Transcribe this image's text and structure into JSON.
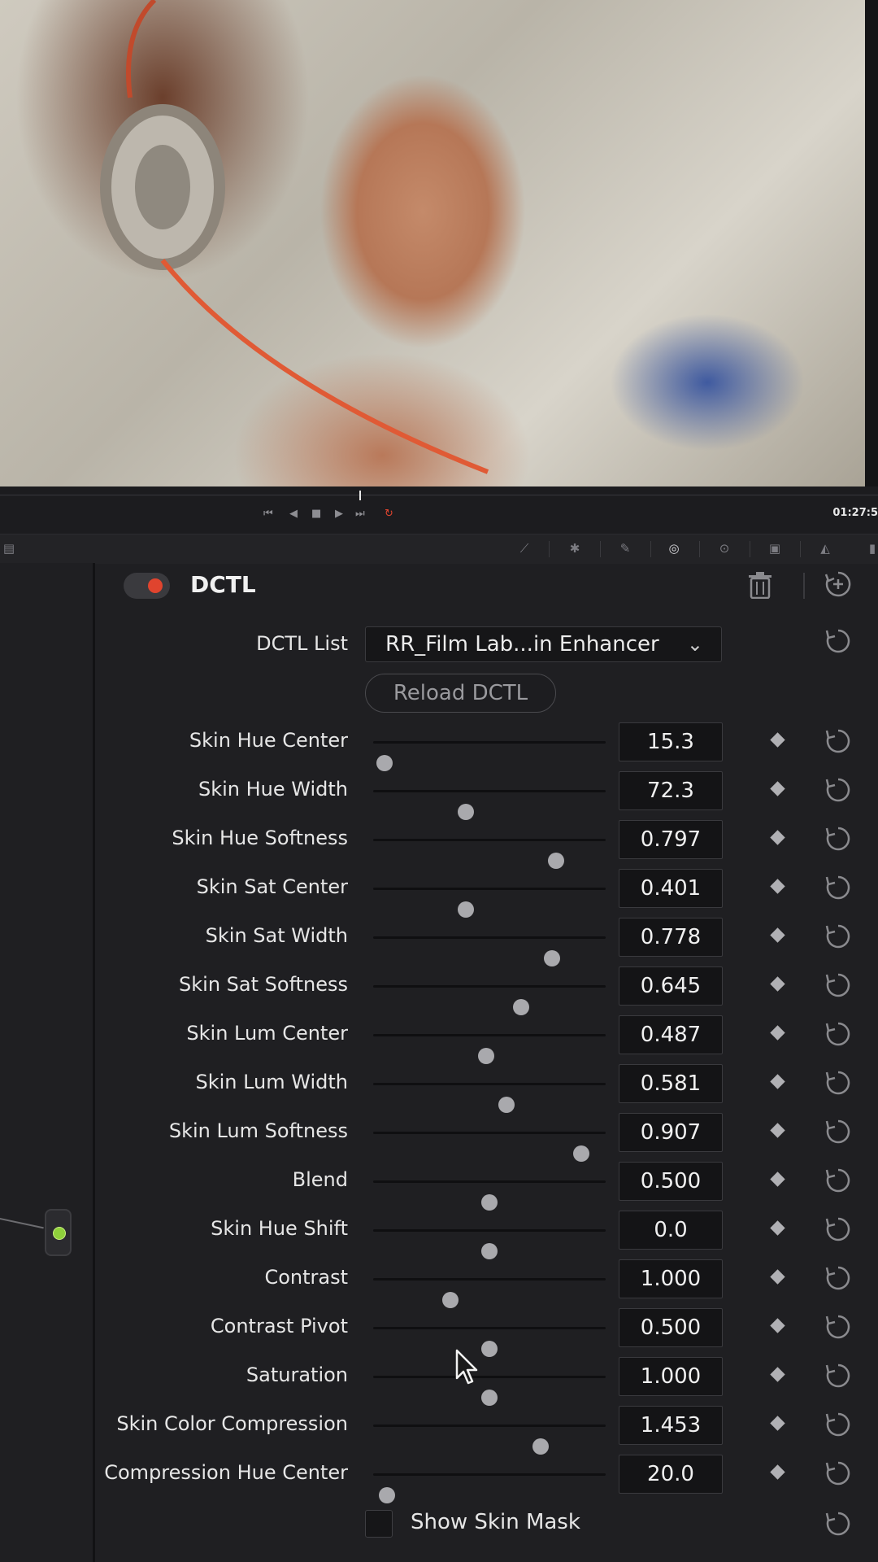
{
  "transport": {
    "timecode": "01:27:5",
    "buttons": [
      "skip-to-start-icon",
      "step-back-icon",
      "stop-icon",
      "play-icon",
      "skip-to-end-icon",
      "loop-icon"
    ]
  },
  "toolstrip": {
    "tools": [
      "curves-icon",
      "color-warper-icon",
      "qualifier-icon",
      "window-icon",
      "tracker-icon",
      "magic-mask-icon",
      "blur-icon",
      "key-icon"
    ]
  },
  "panel": {
    "title": "DCTL",
    "enabled": true
  },
  "dctl_list": {
    "label": "DCTL List",
    "selected": "RR_Film Lab...in Enhancer"
  },
  "reload_label": "Reload DCTL",
  "params": [
    {
      "label": "Skin Hue Center",
      "value": "15.3",
      "slider": 0.05
    },
    {
      "label": "Skin Hue Width",
      "value": "72.3",
      "slider": 0.4
    },
    {
      "label": "Skin Hue Softness",
      "value": "0.797",
      "slider": 0.786
    },
    {
      "label": "Skin Sat Center",
      "value": "0.401",
      "slider": 0.4
    },
    {
      "label": "Skin Sat Width",
      "value": "0.778",
      "slider": 0.768
    },
    {
      "label": "Skin Sat Softness",
      "value": "0.645",
      "slider": 0.638
    },
    {
      "label": "Skin Lum Center",
      "value": "0.487",
      "slider": 0.485
    },
    {
      "label": "Skin Lum Width",
      "value": "0.581",
      "slider": 0.575
    },
    {
      "label": "Skin Lum Softness",
      "value": "0.907",
      "slider": 0.895
    },
    {
      "label": "Blend",
      "value": "0.500",
      "slider": 0.5
    },
    {
      "label": "Skin Hue Shift",
      "value": "0.0",
      "slider": 0.5
    },
    {
      "label": "Contrast",
      "value": "1.000",
      "slider": 0.333
    },
    {
      "label": "Contrast Pivot",
      "value": "0.500",
      "slider": 0.5
    },
    {
      "label": "Saturation",
      "value": "1.000",
      "slider": 0.5
    },
    {
      "label": "Skin Color Compression",
      "value": "1.453",
      "slider": 0.72
    },
    {
      "label": "Compression Hue Center",
      "value": "20.0",
      "slider": 0.06
    }
  ],
  "show_mask": {
    "label": "Show Skin Mask",
    "checked": false
  },
  "colors": {
    "accent_red": "#e0442e",
    "node_green": "#8fd13b"
  }
}
